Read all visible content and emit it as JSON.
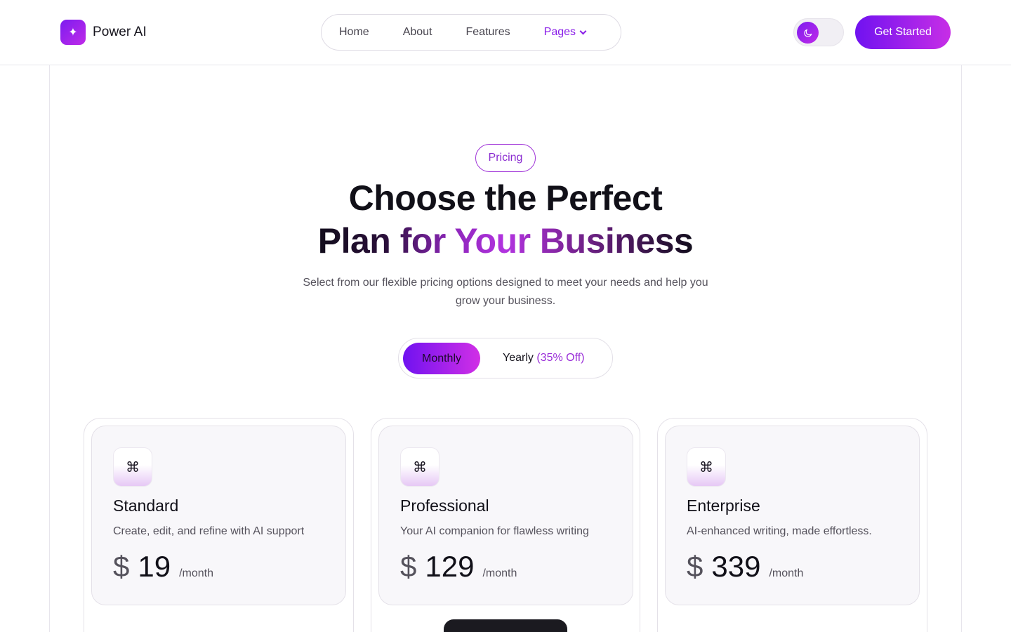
{
  "header": {
    "brand": "Power AI",
    "brand_icon": "sparkle-icon",
    "nav": [
      {
        "label": "Home"
      },
      {
        "label": "About"
      },
      {
        "label": "Features"
      },
      {
        "label": "Pages"
      }
    ],
    "theme_icon": "moon-icon",
    "cta_label": "Get Started"
  },
  "hero": {
    "badge": "Pricing",
    "title_line1": "Choose the Perfect",
    "title_line2": "Plan for Your Business",
    "subtitle": "Select from our flexible pricing options designed to meet your needs and help you grow your business."
  },
  "billing": {
    "monthly": "Monthly",
    "yearly": "Yearly",
    "yearly_discount": "(35% Off)",
    "selected": "Monthly"
  },
  "plans": [
    {
      "icon": "⌘",
      "name": "Standard",
      "description": "Create, edit, and refine with AI support",
      "currency": "$",
      "price": "19",
      "period": "/month"
    },
    {
      "icon": "⌘",
      "name": "Professional",
      "description": "Your AI companion for flawless writing",
      "currency": "$",
      "price": "129",
      "period": "/month"
    },
    {
      "icon": "⌘",
      "name": "Enterprise",
      "description": "AI-enhanced writing, made effortless.",
      "currency": "$",
      "price": "339",
      "period": "/month"
    }
  ],
  "colors": {
    "accent_start": "#7012f0",
    "accent_end": "#c72ee6",
    "accent_text": "#8a1ee8"
  }
}
